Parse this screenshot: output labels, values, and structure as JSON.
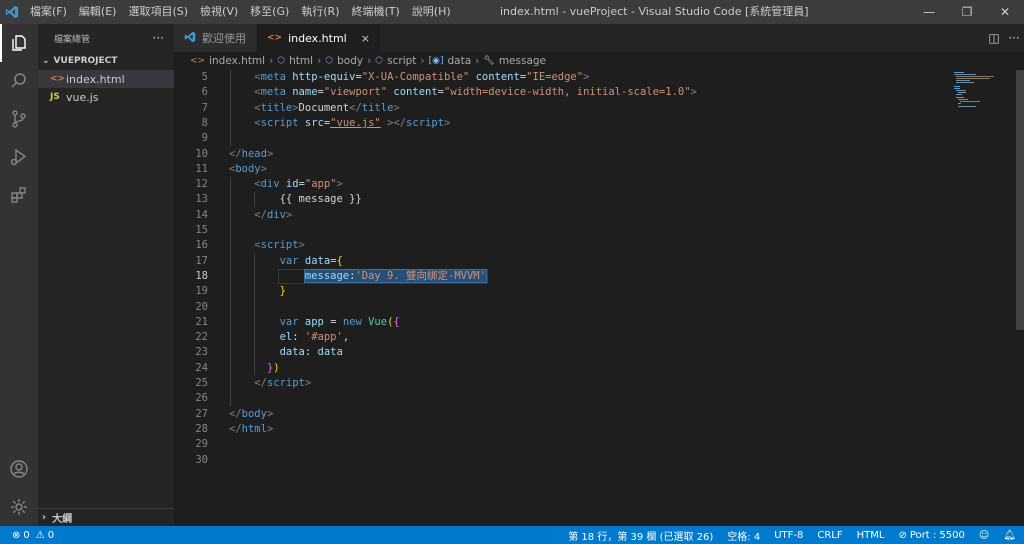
{
  "titlebar": {
    "menu": [
      "檔案(F)",
      "編輯(E)",
      "選取項目(S)",
      "檢視(V)",
      "移至(G)",
      "執行(R)",
      "終端機(T)",
      "說明(H)"
    ],
    "title": "index.html - vueProject - Visual Studio Code [系統管理員]",
    "minimize": "—",
    "restore": "❐",
    "close": "✕"
  },
  "sidebar": {
    "header": "檔案總管",
    "more": "···",
    "project": "VUEPROJECT",
    "files": [
      {
        "icon": "<>",
        "name": "index.html"
      },
      {
        "icon": "JS",
        "name": "vue.js"
      }
    ],
    "outline": "大綱"
  },
  "tabs": [
    {
      "label": "歡迎使用",
      "icon": "vscode-icon"
    },
    {
      "label": "index.html",
      "icon": "html-icon",
      "close": "×"
    }
  ],
  "breadcrumb": [
    "index.html",
    "html",
    "body",
    "script",
    "data",
    "message"
  ],
  "editor": {
    "lines": [
      {
        "n": "5"
      },
      {
        "n": "6"
      },
      {
        "n": "7"
      },
      {
        "n": "8"
      },
      {
        "n": "9"
      },
      {
        "n": "10"
      },
      {
        "n": "11"
      },
      {
        "n": "12"
      },
      {
        "n": "13"
      },
      {
        "n": "14"
      },
      {
        "n": "15"
      },
      {
        "n": "16"
      },
      {
        "n": "17"
      },
      {
        "n": "18"
      },
      {
        "n": "19"
      },
      {
        "n": "20"
      },
      {
        "n": "21"
      },
      {
        "n": "22"
      },
      {
        "n": "23"
      },
      {
        "n": "24"
      },
      {
        "n": "25"
      },
      {
        "n": "26"
      },
      {
        "n": "27"
      },
      {
        "n": "28"
      },
      {
        "n": "29"
      },
      {
        "n": "30"
      }
    ],
    "code": {
      "l5_tag": "meta",
      "l5_a1": "http-equiv",
      "l5_v1": "\"X-UA-Compatible\"",
      "l5_a2": "content",
      "l5_v2": "\"IE=edge\"",
      "l6_tag": "meta",
      "l6_a1": "name",
      "l6_v1": "\"viewport\"",
      "l6_a2": "content",
      "l6_v2": "\"width=device-width, initial-scale=1.0\"",
      "l7_tag": "title",
      "l7_text": "Document",
      "l7_end": "title",
      "l8_tag": "script",
      "l8_a1": "src",
      "l8_v1": "\"vue.js\"",
      "l8_end": "script",
      "l10_tag": "head",
      "l11_tag": "body",
      "l12_tag": "div",
      "l12_a1": "id",
      "l12_v1": "\"app\"",
      "l13_text": "{{ message }}",
      "l14_tag": "div",
      "l16_tag": "script",
      "l17_kw": "var",
      "l17_var": "data",
      "l17_eq": "=",
      "l17_br": "{",
      "l18_key": "message",
      "l18_colon": ":",
      "l18_str": "'Day 9. 雙向綁定-MVVM'",
      "l19_br": "}",
      "l21_kw": "var",
      "l21_var": "app",
      "l21_eq": " = ",
      "l21_new": "new",
      "l21_fn": "Vue",
      "l21_p": "(",
      "l21_b": "{",
      "l22_key": "el",
      "l22_colon": ":",
      "l22_str": "'#app'",
      "l22_comma": ",",
      "l23_key": "data",
      "l23_colon": ":",
      "l23_val": "data",
      "l24_b": "}",
      "l24_p": ")",
      "l25_tag": "script",
      "l27_tag": "body",
      "l28_tag": "html"
    }
  },
  "statusbar": {
    "errors": "0",
    "warnings": "0",
    "position": "第 18 行，第 39 欄 (已選取 26)",
    "spaces": "空格: 4",
    "encoding": "UTF-8",
    "eol": "CRLF",
    "language": "HTML",
    "port": "Port : 5500"
  },
  "colors": {
    "statusbar": "#007acc",
    "activitybar": "#333333",
    "sidebar": "#252526",
    "editor": "#1e1e1e",
    "titlebar": "#3c3c3c"
  }
}
